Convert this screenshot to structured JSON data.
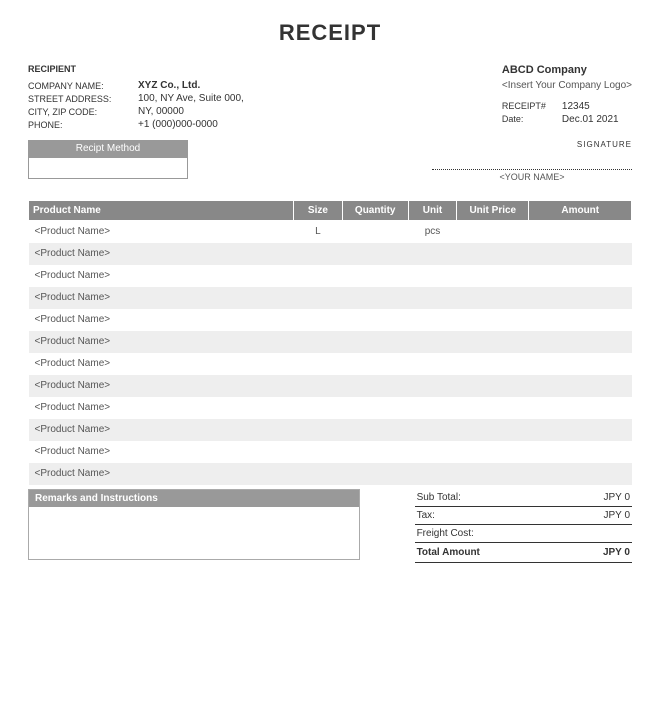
{
  "title": "RECEIPT",
  "recipient": {
    "heading": "RECIPIENT",
    "company_label": "COMPANY NAME:",
    "company_value": "XYZ Co., Ltd.",
    "street_label": "STREET ADDRESS:",
    "street_value": "100, NY Ave, Suite 000,",
    "city_label": "CITY, ZIP CODE:",
    "city_value": "NY, 00000",
    "phone_label": "PHONE:",
    "phone_value": "+1 (000)000-0000"
  },
  "issuer": {
    "company": "ABCD Company",
    "logo_placeholder": "<Insert Your Company Logo>",
    "receipt_label": "RECEIPT#",
    "receipt_value": "12345",
    "date_label": "Date:",
    "date_value": "Dec.01 2021"
  },
  "signature": {
    "label": "SIGNATURE",
    "name_placeholder": "<YOUR NAME>"
  },
  "method": {
    "label": "Recipt Method",
    "value": ""
  },
  "product_headers": {
    "name": "Product Name",
    "size": "Size",
    "quantity": "Quantity",
    "unit": "Unit",
    "unit_price": "Unit Price",
    "amount": "Amount"
  },
  "products": [
    {
      "name": "<Product Name>",
      "size": "L",
      "quantity": "",
      "unit": "pcs",
      "unit_price": "",
      "amount": ""
    },
    {
      "name": "<Product Name>",
      "size": "",
      "quantity": "",
      "unit": "",
      "unit_price": "",
      "amount": ""
    },
    {
      "name": "<Product Name>",
      "size": "",
      "quantity": "",
      "unit": "",
      "unit_price": "",
      "amount": ""
    },
    {
      "name": "<Product Name>",
      "size": "",
      "quantity": "",
      "unit": "",
      "unit_price": "",
      "amount": ""
    },
    {
      "name": "<Product Name>",
      "size": "",
      "quantity": "",
      "unit": "",
      "unit_price": "",
      "amount": ""
    },
    {
      "name": "<Product Name>",
      "size": "",
      "quantity": "",
      "unit": "",
      "unit_price": "",
      "amount": ""
    },
    {
      "name": "<Product Name>",
      "size": "",
      "quantity": "",
      "unit": "",
      "unit_price": "",
      "amount": ""
    },
    {
      "name": "<Product Name>",
      "size": "",
      "quantity": "",
      "unit": "",
      "unit_price": "",
      "amount": ""
    },
    {
      "name": "<Product Name>",
      "size": "",
      "quantity": "",
      "unit": "",
      "unit_price": "",
      "amount": ""
    },
    {
      "name": "<Product Name>",
      "size": "",
      "quantity": "",
      "unit": "",
      "unit_price": "",
      "amount": ""
    },
    {
      "name": "<Product Name>",
      "size": "",
      "quantity": "",
      "unit": "",
      "unit_price": "",
      "amount": ""
    },
    {
      "name": "<Product Name>",
      "size": "",
      "quantity": "",
      "unit": "",
      "unit_price": "",
      "amount": ""
    }
  ],
  "remarks": {
    "header": "Remarks and Instructions",
    "body": ""
  },
  "totals": {
    "subtotal_label": "Sub Total:",
    "subtotal_value": "JPY 0",
    "tax_label": "Tax:",
    "tax_value": "JPY 0",
    "freight_label": "Freight Cost:",
    "freight_value": "",
    "total_label": "Total Amount",
    "total_value": "JPY 0"
  }
}
